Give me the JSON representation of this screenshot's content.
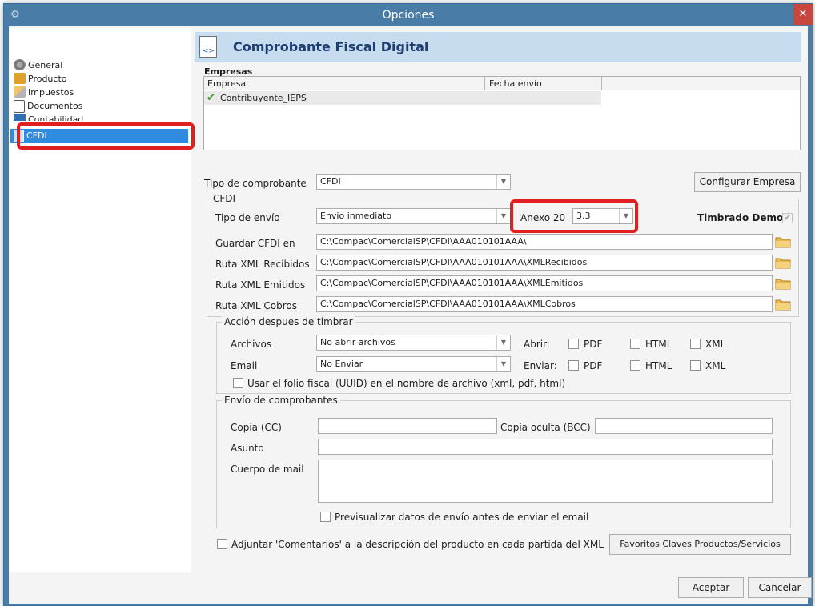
{
  "window": {
    "title": "Opciones",
    "close_glyph": "✕",
    "app_icon": "gear-icon"
  },
  "nav": {
    "items": [
      {
        "label": "General",
        "icon": "gear-icon"
      },
      {
        "label": "Producto",
        "icon": "box-icon"
      },
      {
        "label": "Impuestos",
        "icon": "tax-icon"
      },
      {
        "label": "Documentos",
        "icon": "document-icon"
      },
      {
        "label": "Contabilidad",
        "icon": "books-icon"
      },
      {
        "label": "CFDI",
        "icon": "cfdi-icon",
        "selected": true
      }
    ]
  },
  "header": {
    "title": "Comprobante Fiscal Digital",
    "icon": "xml-document-icon"
  },
  "empresas": {
    "group_label": "Empresas",
    "columns": [
      "Empresa",
      "Fecha envío"
    ],
    "rows": [
      {
        "empresa": "Contribuyente_IEPS",
        "fecha_envio": "",
        "status_icon": "check-icon"
      }
    ]
  },
  "tipo_comprobante": {
    "label": "Tipo de comprobante",
    "value": "CFDI",
    "configurar_button": "Configurar Empresa"
  },
  "cfdi": {
    "group_label": "CFDI",
    "tipo_envio": {
      "label": "Tipo de envío",
      "value": "Envio inmediato"
    },
    "anexo": {
      "label": "Anexo 20",
      "value": "3.3"
    },
    "timbrado_demo": {
      "label": "Timbrado Demo",
      "checked": true
    },
    "paths": [
      {
        "label": "Guardar CFDI en",
        "value": "C:\\Compac\\ComercialSP\\CFDI\\AAA010101AAA\\"
      },
      {
        "label": "Ruta XML Recibidos",
        "value": "C:\\Compac\\ComercialSP\\CFDI\\AAA010101AAA\\XMLRecibidos"
      },
      {
        "label": "Ruta XML Emitidos",
        "value": "C:\\Compac\\ComercialSP\\CFDI\\AAA010101AAA\\XMLEmitidos"
      },
      {
        "label": "Ruta XML Cobros",
        "value": "C:\\Compac\\ComercialSP\\CFDI\\AAA010101AAA\\XMLCobros"
      }
    ]
  },
  "accion": {
    "group_label": "Acción despues de timbrar",
    "archivos": {
      "label": "Archivos",
      "value": "No abrir archivos",
      "abrir_label": "Abrir:"
    },
    "email": {
      "label": "Email",
      "value": "No Enviar",
      "enviar_label": "Enviar:"
    },
    "formats": [
      "PDF",
      "HTML",
      "XML"
    ],
    "uuid_label": "Usar el folio fiscal (UUID) en el nombre de archivo (xml, pdf, html)"
  },
  "envio": {
    "group_label": "Envío de comprobantes",
    "copia_label": "Copia (CC)",
    "copia_oculta_label": "Copia oculta (BCC)",
    "asunto_label": "Asunto",
    "cuerpo_label": "Cuerpo de mail",
    "previsualizar_label": "Previsualizar datos de envío antes de enviar el email"
  },
  "adjuntar_label": "Adjuntar 'Comentarios' a la descripción del producto en cada partida del XML",
  "favoritos_button": "Favoritos Claves Productos/Servicios",
  "footer": {
    "aceptar": "Aceptar",
    "cancelar": "Cancelar"
  },
  "colors": {
    "highlight": "#e02020",
    "selection": "#2f8be0",
    "header_bg": "#c8dcef",
    "title_bar": "#4a7ca8"
  }
}
